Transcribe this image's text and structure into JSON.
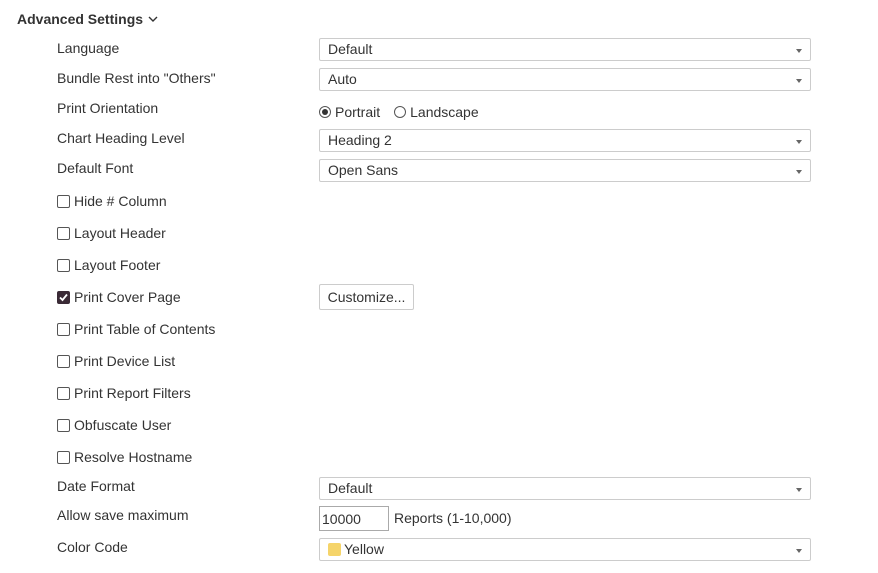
{
  "section": {
    "title": "Advanced Settings"
  },
  "language": {
    "label": "Language",
    "value": "Default"
  },
  "bundle": {
    "label": "Bundle Rest into \"Others\"",
    "value": "Auto"
  },
  "orientation": {
    "label": "Print Orientation",
    "options": [
      {
        "label": "Portrait",
        "selected": true
      },
      {
        "label": "Landscape",
        "selected": false
      }
    ]
  },
  "heading_level": {
    "label": "Chart Heading Level",
    "value": "Heading 2"
  },
  "default_font": {
    "label": "Default Font",
    "value": "Open Sans"
  },
  "checkboxes": [
    {
      "label": "Hide # Column",
      "checked": false
    },
    {
      "label": "Layout Header",
      "checked": false
    },
    {
      "label": "Layout Footer",
      "checked": false
    },
    {
      "label": "Print Cover Page",
      "checked": true
    },
    {
      "label": "Print Table of Contents",
      "checked": false
    },
    {
      "label": "Print Device List",
      "checked": false
    },
    {
      "label": "Print Report Filters",
      "checked": false
    },
    {
      "label": "Obfuscate User",
      "checked": false
    },
    {
      "label": "Resolve Hostname",
      "checked": false
    }
  ],
  "customize_button": {
    "label": "Customize..."
  },
  "date_format": {
    "label": "Date Format",
    "value": "Default"
  },
  "save_max": {
    "label": "Allow save maximum",
    "value": "10000",
    "suffix": "Reports (1-10,000)"
  },
  "color_code": {
    "label": "Color Code",
    "value": "Yellow",
    "swatch_color": "#f5d46a"
  },
  "colors": {
    "checkbox_checked": "#3a2a36",
    "border": "#cccccc",
    "text": "#333333"
  }
}
